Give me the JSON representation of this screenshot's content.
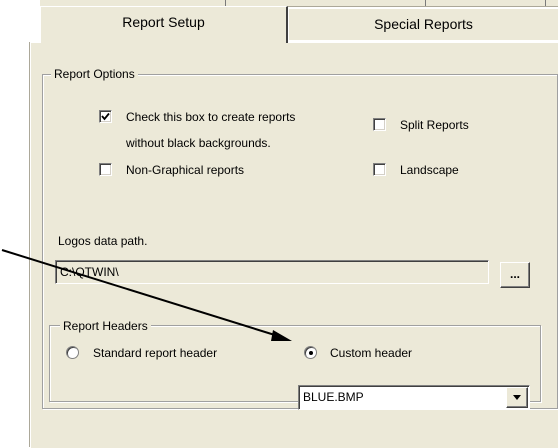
{
  "tabs": {
    "report_setup": "Report Setup",
    "special_reports": "Special Reports"
  },
  "report_options": {
    "legend": "Report Options",
    "no_black_bg": {
      "label_line1": "Check this box to create reports",
      "label_line2": "without black backgrounds.",
      "checked": true
    },
    "split_reports": {
      "label": "Split Reports",
      "checked": false
    },
    "non_graphical": {
      "label": "Non-Graphical reports",
      "checked": false
    },
    "landscape": {
      "label": "Landscape",
      "checked": false
    }
  },
  "logos": {
    "label": "Logos data path.",
    "path_value": "C:\\QTWIN\\",
    "browse_label": "..."
  },
  "report_headers": {
    "legend": "Report Headers",
    "standard": {
      "label": "Standard report header",
      "selected": false
    },
    "custom": {
      "label": "Custom header",
      "selected": true
    },
    "header_file": "BLUE.BMP"
  },
  "colors": {
    "panel_bg": "#ece9d8",
    "annotation_arrow": "#000000"
  },
  "icons": {
    "checkmark": "check-icon",
    "dropdown": "chevron-down-icon",
    "arrow": "arrow-icon"
  }
}
